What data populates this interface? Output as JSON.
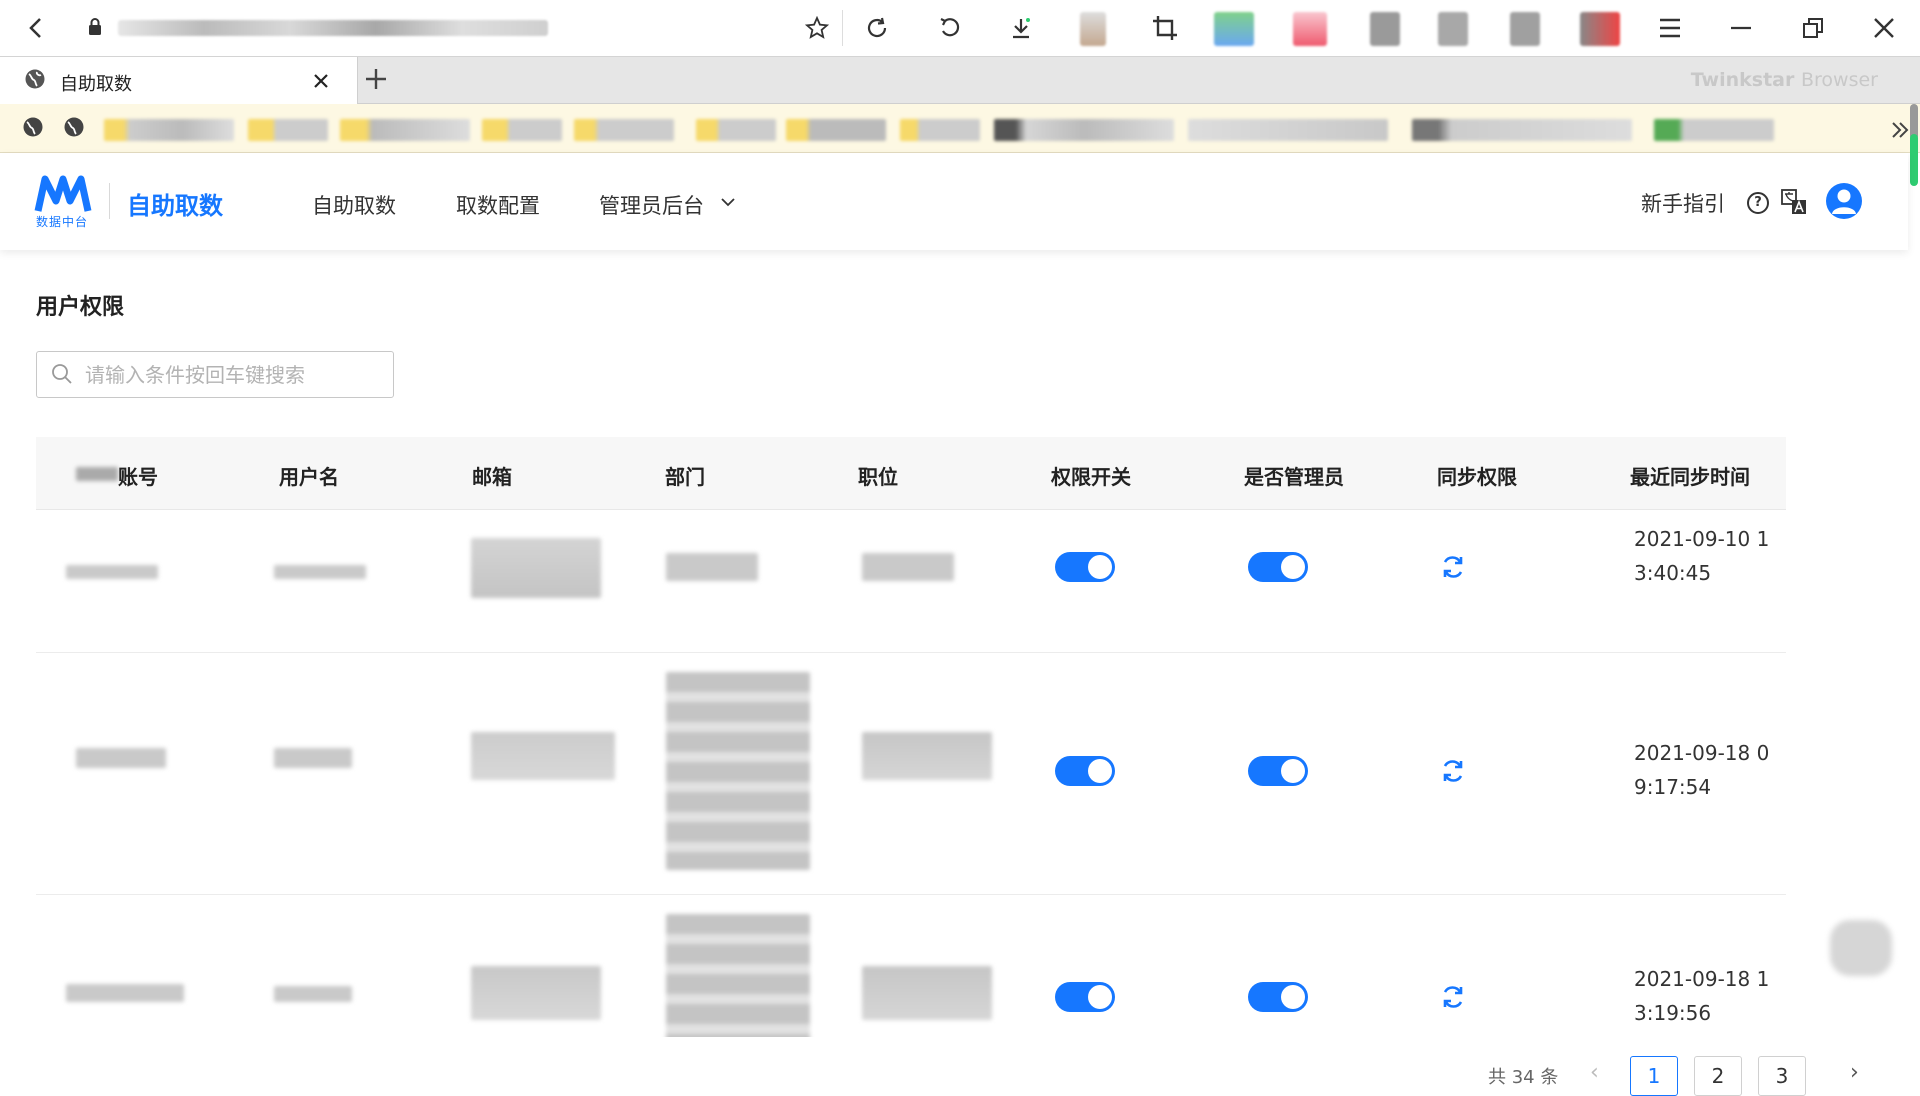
{
  "browser": {
    "tab_title": "自助取数",
    "brand_name": "Twinkstar",
    "brand_suffix": "Browser",
    "toolbar_icons": [
      "back-icon",
      "star-icon",
      "reload-icon",
      "undo-icon",
      "download-icon",
      "crop-icon",
      "menu-icon",
      "minimize-icon",
      "restore-icon",
      "close-icon"
    ]
  },
  "app": {
    "logo_sub": "数据中台",
    "title": "自助取数",
    "nav": [
      "自助取数",
      "取数配置",
      "管理员后台"
    ],
    "guide": "新手指引",
    "accent": "#1677ff"
  },
  "page": {
    "title": "用户权限",
    "search_placeholder": "请输入条件按回车键搜索"
  },
  "table": {
    "headers": [
      "账号",
      "用户名",
      "邮箱",
      "部门",
      "职位",
      "权限开关",
      "是否管理员",
      "同步权限",
      "最近同步时间"
    ],
    "rows": [
      {
        "perm_on": true,
        "admin_on": true,
        "sync_time": "2021-09-10 13:40:45"
      },
      {
        "perm_on": true,
        "admin_on": true,
        "sync_time": "2021-09-18 09:17:54"
      },
      {
        "perm_on": true,
        "admin_on": true,
        "sync_time": "2021-09-18 13:19:56"
      }
    ]
  },
  "pagination": {
    "total": "共 34 条",
    "pages": [
      "1",
      "2",
      "3"
    ],
    "current": "1"
  }
}
